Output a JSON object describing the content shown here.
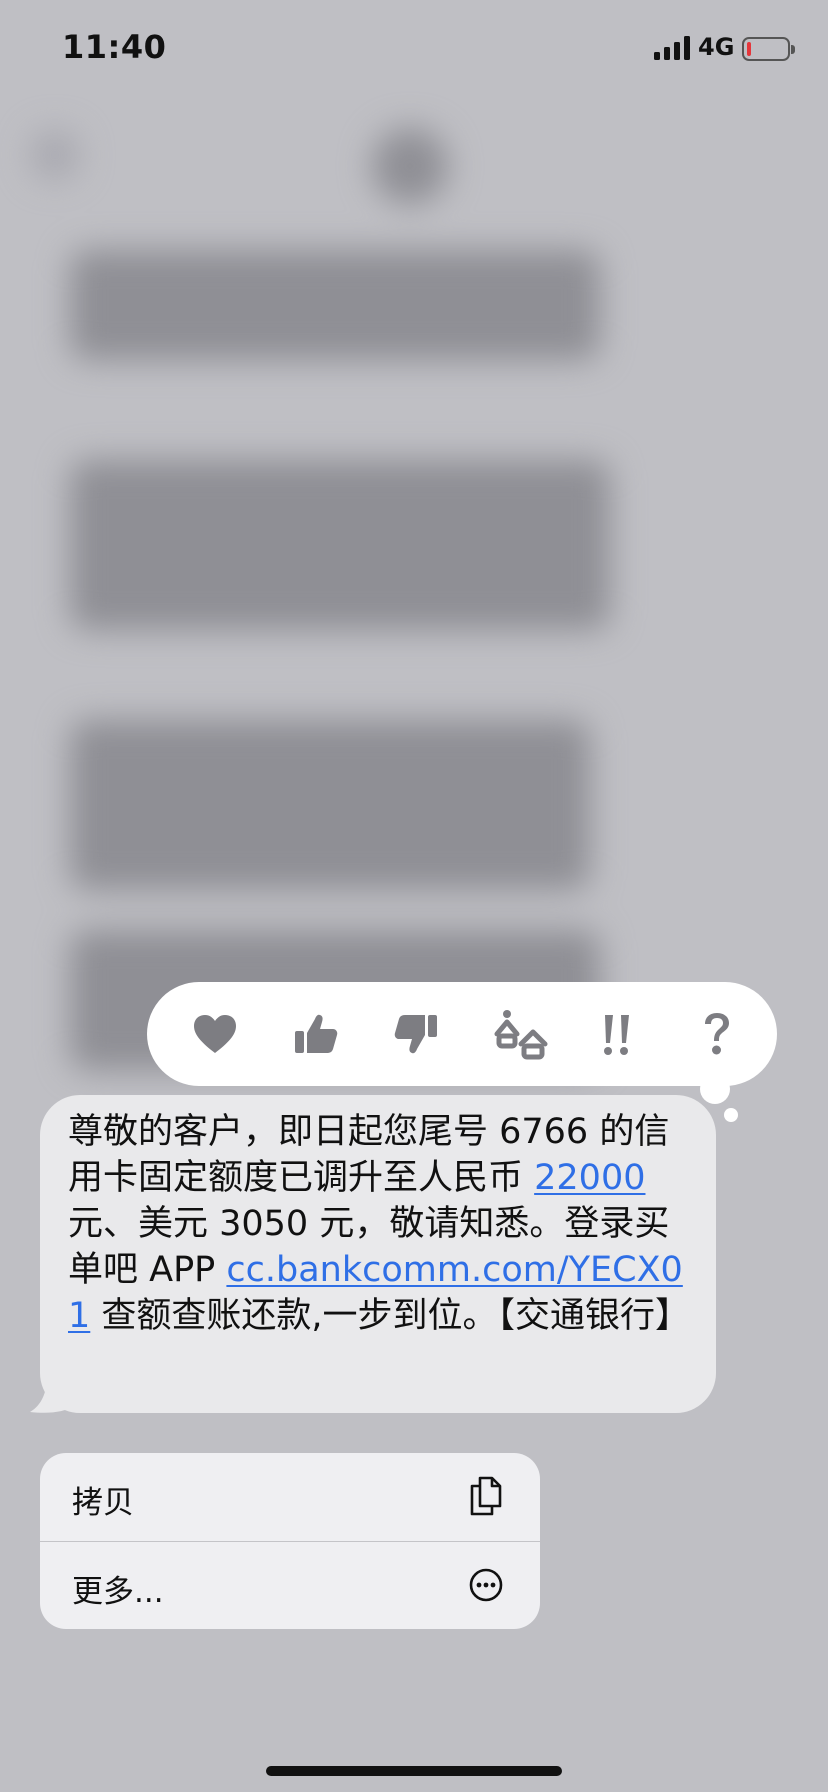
{
  "status_bar": {
    "time": "11:40",
    "network": "4G",
    "battery_level": 0.1
  },
  "reactions": [
    {
      "name": "heart-icon",
      "label": "heart"
    },
    {
      "name": "thumbs-up-icon",
      "label": "thumbs up"
    },
    {
      "name": "thumbs-down-icon",
      "label": "thumbs down"
    },
    {
      "name": "haha-icon",
      "label": "haha"
    },
    {
      "name": "exclamation-icon",
      "label": "exclamation"
    },
    {
      "name": "question-icon",
      "label": "question"
    }
  ],
  "message": {
    "part1": "尊敬的客户，即日起您尾号 6766 的信用卡固定额度已调升至人民币 ",
    "amount_link": "22000",
    "part2": " 元、美元 3050 元，敬请知悉。登录买单吧 APP ",
    "url_link": "cc.bankcomm.com/YECX01",
    "part3": " 查额查账还款,一步到位。【交通银行】"
  },
  "menu": {
    "copy_label": "拷贝",
    "more_label": "更多..."
  },
  "colors": {
    "link": "#2f6fe6",
    "bubble": "#e9e9eb",
    "reaction_icon": "#7d7d82",
    "battery_low": "#e5363b"
  }
}
